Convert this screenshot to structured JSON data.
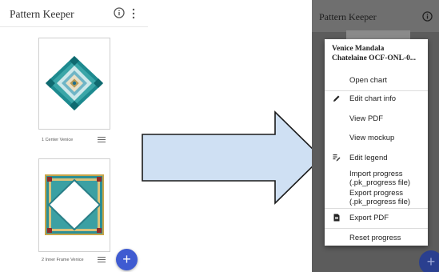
{
  "left": {
    "app_title": "Pattern Keeper",
    "icons": {
      "info": "info-icon",
      "more": "more-vert-icon",
      "add": "plus-icon",
      "menu": "hamburger-icon"
    },
    "charts": [
      {
        "caption": "1 Center Venice"
      },
      {
        "caption": "2 Inner Frame Venice"
      }
    ],
    "fab_symbol": "+"
  },
  "right": {
    "app_title": "Pattern Keeper",
    "fab_symbol": "+",
    "menu": {
      "header_line1": "Venice Mandala",
      "header_line2": "Chatelaine OCF-ONL-0...",
      "items": [
        {
          "label": "Open chart",
          "icon": ""
        },
        {
          "label": "Edit chart info",
          "icon": "pencil-icon"
        },
        {
          "label": "View PDF",
          "icon": ""
        },
        {
          "label": "View mockup",
          "icon": ""
        },
        {
          "label": "Edit legend",
          "icon": "edit-list-icon"
        },
        {
          "label_line1": "Import progress",
          "label_line2": "(.pk_progress file)",
          "icon": ""
        },
        {
          "label_line1": "Export progress",
          "label_line2": "(.pk_progress file)",
          "icon": ""
        },
        {
          "label": "Export PDF",
          "icon": "pdf-file-icon"
        },
        {
          "label": "Reset progress",
          "icon": ""
        }
      ]
    }
  },
  "colors": {
    "fab": "#3f5bd1",
    "arrow_fill": "#cfe0f3",
    "overlay": "#5c5c5c"
  }
}
